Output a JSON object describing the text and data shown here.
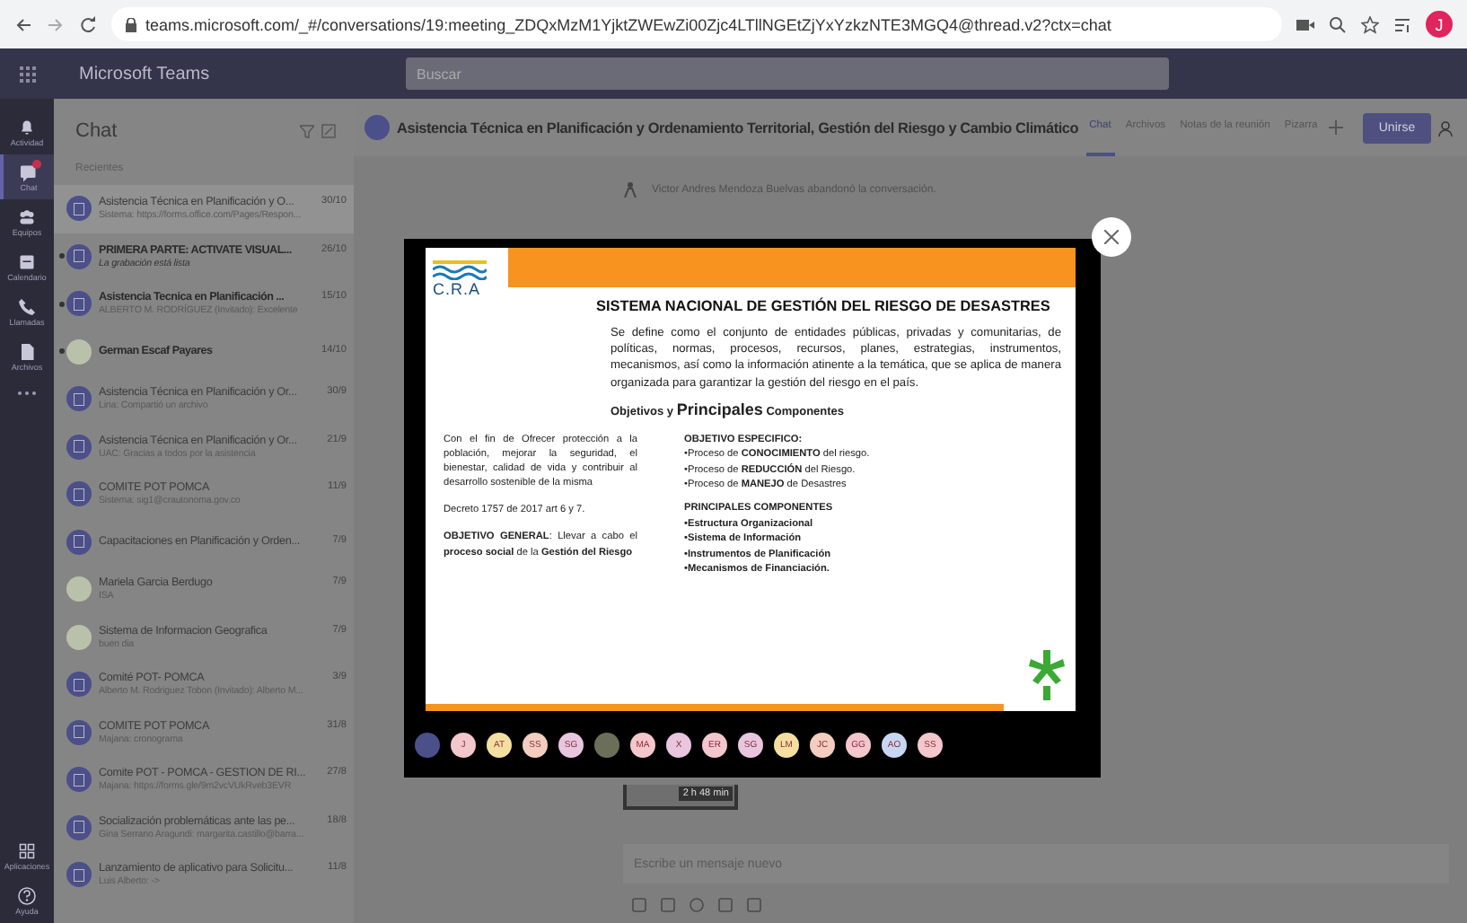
{
  "browser": {
    "url": "teams.microsoft.com/_#/conversations/19:meeting_ZDQxMzM1YjktZWEwZi00Zjc4LTllNGEtZjYxYzkzNTE3MGQ4@thread.v2?ctx=chat",
    "profile": "J"
  },
  "app": {
    "title": "Microsoft Teams",
    "search_placeholder": "Buscar"
  },
  "rail": [
    {
      "label": "Actividad",
      "selected": false,
      "notification": false
    },
    {
      "label": "Chat",
      "selected": true,
      "notification": true
    },
    {
      "label": "Equipos",
      "selected": false,
      "notification": false
    },
    {
      "label": "Calendario",
      "selected": false,
      "notification": false
    },
    {
      "label": "Llamadas",
      "selected": false,
      "notification": false
    },
    {
      "label": "Archivos",
      "selected": false,
      "notification": false
    }
  ],
  "rail_bottom": [
    {
      "label": "Aplicaciones"
    },
    {
      "label": "Ayuda"
    }
  ],
  "chat_list": {
    "title": "Chat",
    "section": "Recientes",
    "items": [
      {
        "kind": "channel",
        "title": "Asistencia Técnica en Planificación y O...",
        "date": "30/10",
        "preview": "Sistema: https://forms.office.com/Pages/Respon...",
        "unread": false,
        "selected": true,
        "preview_italic": false
      },
      {
        "kind": "channel",
        "title": "PRIMERA PARTE: ACTIVATE VISUAL...",
        "date": "26/10",
        "preview": "La grabación está lista",
        "unread": true,
        "selected": false,
        "preview_italic": true
      },
      {
        "kind": "channel",
        "title": "Asistencia Tecnica en Planificación ...",
        "date": "15/10",
        "preview": "ALBERTO M. RODRÍGUEZ (Invitado): Excelente",
        "unread": true,
        "selected": false,
        "preview_italic": false
      },
      {
        "kind": "person",
        "title": "German Escaf Payares",
        "date": "14/10",
        "unread": true,
        "selected": false
      },
      {
        "kind": "channel",
        "title": "Asistencia Técnica en Planificación y Or...",
        "date": "30/9",
        "preview": "Lina: Compartió un archivo",
        "unread": false,
        "selected": false,
        "preview_italic": false
      },
      {
        "kind": "channel",
        "title": "Asistencia Técnica en Planificación y Or...",
        "date": "21/9",
        "preview": "UAC: Gracias a todos por la asistencia",
        "unread": false,
        "selected": false,
        "preview_italic": false
      },
      {
        "kind": "channel",
        "title": "COMITE POT POMCA",
        "date": "11/9",
        "preview": "Sistema: sig1@crautonoma.gov.co",
        "unread": false,
        "selected": false,
        "preview_italic": false
      },
      {
        "kind": "channel",
        "title": "Capacitaciones en Planificación y Orden...",
        "date": "7/9",
        "unread": false,
        "selected": false
      },
      {
        "kind": "person",
        "title": "Mariela Garcia Berdugo",
        "date": "7/9",
        "preview": "ISA",
        "unread": false,
        "selected": false,
        "preview_italic": false
      },
      {
        "kind": "person",
        "title": "Sistema de Informacion Geografica",
        "date": "7/9",
        "preview": "buen dia",
        "unread": false,
        "selected": false,
        "preview_italic": false
      },
      {
        "kind": "channel",
        "title": "Comité POT- POMCA",
        "date": "3/9",
        "preview": "Alberto M. Rodriguez Tobon (Invitado): Alberto M...",
        "unread": false,
        "selected": false,
        "preview_italic": false
      },
      {
        "kind": "channel",
        "title": "COMITE POT POMCA",
        "date": "31/8",
        "preview": "Majana: cronograma",
        "unread": false,
        "selected": false,
        "preview_italic": false
      },
      {
        "kind": "channel",
        "title": "Comite POT - POMCA - GESTION DE RI...",
        "date": "27/8",
        "preview": "Majana: https://forms.gle/9m2vcVUkRveb3EVR",
        "unread": false,
        "selected": false,
        "preview_italic": false
      },
      {
        "kind": "channel",
        "title": "Socialización problemáticas ante las pe...",
        "date": "18/8",
        "preview": "Gina Serrano Aragundi: margarita.castillo@barra...",
        "unread": false,
        "selected": false,
        "preview_italic": false
      },
      {
        "kind": "channel",
        "title": "Lanzamiento de aplicativo para Solicitu...",
        "date": "11/8",
        "preview": "Luis Alberto: ->",
        "unread": false,
        "selected": false,
        "preview_italic": false
      }
    ]
  },
  "header": {
    "title": "Asistencia Técnica en Planificación y Ordenamiento Territorial, Gestión del Riesgo y Cambio Climático",
    "tabs": [
      {
        "label": "Chat",
        "selected": true
      },
      {
        "label": "Archivos",
        "selected": false
      },
      {
        "label": "Notas de la reunión",
        "selected": false
      },
      {
        "label": "Pizarra",
        "selected": false
      }
    ],
    "join_button": "Unirse"
  },
  "conversation": {
    "system_note": "Victor Andres Mendoza Buelvas abandonó la conversación.",
    "video_duration": "2 h 48 min",
    "compose_placeholder": "Escribe un mensaje nuevo"
  },
  "slide": {
    "logo": "C.R.A",
    "title": "SISTEMA NACIONAL DE GESTIÓN DEL RIESGO DE DESASTRES",
    "definition": "Se define como el conjunto de entidades públicas, privadas y comunitarias, de políticas, normas, procesos, recursos, planes, estrategias, instrumentos, mecanismos, así como la información atinente a la temática, que se aplica de manera organizada para garantizar la gestión del riesgo en el país.",
    "subtitle": "Objetivos y **Principales** Componentes",
    "left": [
      "Con el fin de Ofrecer protección a la población, mejorar la seguridad, el bienestar, calidad de vida y contribuir al desarrollo sostenible de la misma",
      "Decreto 1757 de 2017 art 6 y 7.",
      "**OBJETIVO GENERAL**: Llevar a cabo el **proceso social** de la **Gestión del Riesgo**"
    ],
    "specific_heading": "OBJETIVO ESPECIFICO:",
    "specific": [
      "•Proceso de **CONOCIMIENTO** del riesgo.",
      "•Proceso de **REDUCCIÓN** del Riesgo.",
      "•Proceso de **MANEJO** de Desastres"
    ],
    "components_heading": "PRINCIPALES COMPONENTES",
    "components": [
      "•Estructura Organizacional",
      "•Sistema de Información",
      "•Instrumentos de Planificación",
      "•Mecanismos de Financiación."
    ]
  },
  "participants": [
    {
      "kind": "more",
      "color": "#4b4f8a"
    },
    {
      "kind": "initials",
      "initials": "J",
      "color": "#f3c7cb"
    },
    {
      "kind": "initials",
      "initials": "AT",
      "color": "#f3e0a0"
    },
    {
      "kind": "initials",
      "initials": "SS",
      "color": "#f3cdbd"
    },
    {
      "kind": "initials",
      "initials": "SG",
      "color": "#e9c6df"
    },
    {
      "kind": "photo",
      "color": "#6b6f5a"
    },
    {
      "kind": "initials",
      "initials": "MA",
      "color": "#f3c7cb"
    },
    {
      "kind": "initials",
      "initials": "X",
      "color": "#e9c6df"
    },
    {
      "kind": "initials",
      "initials": "ER",
      "color": "#f3c7cb"
    },
    {
      "kind": "initials",
      "initials": "SG",
      "color": "#e9c6df"
    },
    {
      "kind": "initials",
      "initials": "LM",
      "color": "#f3e0a0"
    },
    {
      "kind": "initials",
      "initials": "JC",
      "color": "#f3cdbd"
    },
    {
      "kind": "initials",
      "initials": "GG",
      "color": "#f3c7cb"
    },
    {
      "kind": "initials",
      "initials": "AO",
      "color": "#c9d6f3"
    },
    {
      "kind": "initials",
      "initials": "SS",
      "color": "#f3c7cb"
    }
  ]
}
